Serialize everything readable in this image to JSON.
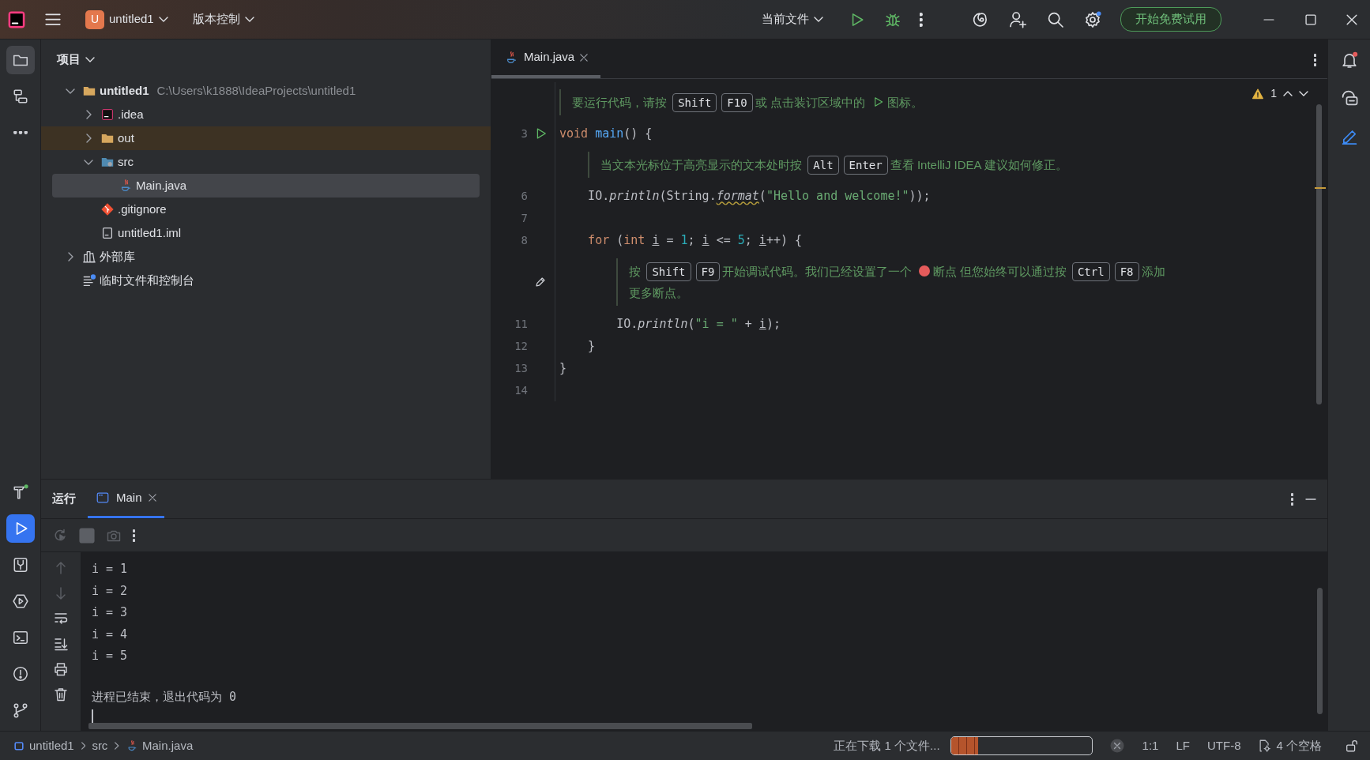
{
  "title_bar": {
    "project_badge": "U",
    "project": "untitled1",
    "vcs": "版本控制",
    "run_config": "当前文件",
    "trial_button": "开始免费试用"
  },
  "left_strip": {
    "top": [
      {
        "selected": true
      },
      {
        "selected": false
      },
      {
        "selected": false
      }
    ],
    "bottom": [
      {
        "selected": false
      },
      {
        "selected": true
      },
      {
        "selected": false
      },
      {
        "selected": false
      },
      {
        "selected": false
      },
      {
        "selected": false
      },
      {
        "selected": false
      }
    ]
  },
  "project_panel": {
    "title": "项目",
    "tree": [
      {
        "label": "untitled1",
        "path": "C:\\Users\\k1888\\IdeaProjects\\untitled1",
        "kind": "module",
        "expanded": true,
        "selected": false,
        "highlighted": false,
        "children": [
          {
            "label": ".idea",
            "kind": "config",
            "expanded": false,
            "selected": false,
            "highlighted": false
          },
          {
            "label": "out",
            "kind": "folder",
            "expanded": false,
            "selected": false,
            "highlighted": true
          },
          {
            "label": "src",
            "kind": "source",
            "expanded": true,
            "selected": false,
            "highlighted": false,
            "children": [
              {
                "label": "Main.java",
                "kind": "java",
                "selected": true,
                "highlighted": false
              }
            ]
          },
          {
            "label": ".gitignore",
            "kind": "gitignore",
            "selected": false,
            "highlighted": false
          },
          {
            "label": "untitled1.iml",
            "kind": "iml",
            "selected": false,
            "highlighted": false
          }
        ]
      },
      {
        "label": "外部库",
        "kind": "library",
        "expanded": false,
        "selected": false,
        "highlighted": false
      },
      {
        "label": "临时文件和控制台",
        "kind": "scratch",
        "selected": false,
        "highlighted": false
      }
    ]
  },
  "editor": {
    "tabs": [
      {
        "label": "Main.java",
        "selected": true
      }
    ],
    "warning_count": "1",
    "lines": [
      {
        "kind": "hint",
        "editable": false,
        "parts": [
          {
            "kind": "text",
            "text": "要运行代码，请按"
          },
          {
            "kind": "key",
            "text": "Shift"
          },
          {
            "kind": "key",
            "text": "F10"
          },
          {
            "kind": "text",
            "text": "或 点击装订区域中的"
          },
          {
            "kind": "run"
          },
          {
            "kind": "text",
            "text": "图标。"
          }
        ]
      },
      {
        "kind": "code",
        "number": "3",
        "runnable": true,
        "tokens": [
          {
            "kind": "kw",
            "text": "void "
          },
          {
            "kind": "fn",
            "text": "main"
          },
          {
            "kind": "plain",
            "text": "() {"
          }
        ],
        "children": [
          {
            "kind": "hint",
            "editable": false,
            "parts": [
              {
                "kind": "text",
                "text": "当文本光标位于高亮显示的文本处时按"
              },
              {
                "kind": "key",
                "text": "Alt"
              },
              {
                "kind": "key",
                "text": "Enter"
              },
              {
                "kind": "text",
                "text": "查看 IntelliJ IDEA 建议如何修正。"
              }
            ]
          },
          {
            "kind": "code",
            "number": "6",
            "runnable": false,
            "tokens": [
              {
                "kind": "plain",
                "text": "IO."
              },
              {
                "kind": "italic",
                "text": "println"
              },
              {
                "kind": "plain",
                "text": "(String."
              },
              {
                "kind": "warn",
                "text": "format"
              },
              {
                "kind": "plain",
                "text": "("
              },
              {
                "kind": "str",
                "text": "\"Hello and welcome!\""
              },
              {
                "kind": "plain",
                "text": "));"
              }
            ]
          },
          {
            "kind": "code",
            "number": "7",
            "runnable": false
          },
          {
            "kind": "code",
            "number": "8",
            "runnable": false,
            "tokens": [
              {
                "kind": "kw",
                "text": "for"
              },
              {
                "kind": "plain",
                "text": " ("
              },
              {
                "kind": "kw",
                "text": "int "
              },
              {
                "kind": "var",
                "text": "i"
              },
              {
                "kind": "plain",
                "text": " = "
              },
              {
                "kind": "num",
                "text": "1"
              },
              {
                "kind": "plain",
                "text": "; "
              },
              {
                "kind": "var",
                "text": "i"
              },
              {
                "kind": "plain",
                "text": " <= "
              },
              {
                "kind": "num",
                "text": "5"
              },
              {
                "kind": "plain",
                "text": "; "
              },
              {
                "kind": "var",
                "text": "i"
              },
              {
                "kind": "plain",
                "text": "++) {"
              }
            ],
            "children": [
              {
                "kind": "hint",
                "editable": true,
                "parts": [
                  {
                    "kind": "text",
                    "text": "按"
                  },
                  {
                    "kind": "key",
                    "text": "Shift"
                  },
                  {
                    "kind": "key",
                    "text": "F9"
                  },
                  {
                    "kind": "text",
                    "text": "开始调试代码。我们已经设置了一个"
                  },
                  {
                    "kind": "breakpoint"
                  },
                  {
                    "kind": "text",
                    "text": "断点 但您始终可以通过按"
                  },
                  {
                    "kind": "key",
                    "text": "Ctrl"
                  },
                  {
                    "kind": "key",
                    "text": "F8"
                  },
                  {
                    "kind": "text",
                    "text": "添加"
                  },
                  {
                    "kind": "break"
                  },
                  {
                    "kind": "text",
                    "text": "更多断点。"
                  }
                ]
              },
              {
                "kind": "code",
                "number": "11",
                "runnable": false,
                "tokens": [
                  {
                    "kind": "plain",
                    "text": "IO."
                  },
                  {
                    "kind": "italic",
                    "text": "println"
                  },
                  {
                    "kind": "plain",
                    "text": "("
                  },
                  {
                    "kind": "str",
                    "text": "\"i = \""
                  },
                  {
                    "kind": "plain",
                    "text": " + "
                  },
                  {
                    "kind": "var",
                    "text": "i"
                  },
                  {
                    "kind": "plain",
                    "text": ");"
                  }
                ]
              }
            ]
          },
          {
            "kind": "code",
            "number": "12",
            "runnable": false,
            "tokens": [
              {
                "kind": "plain",
                "text": "}"
              }
            ]
          }
        ]
      },
      {
        "kind": "code",
        "number": "13",
        "runnable": false,
        "tokens": [
          {
            "kind": "plain",
            "text": "}"
          }
        ]
      },
      {
        "kind": "code",
        "number": "14",
        "runnable": false
      }
    ]
  },
  "run_panel": {
    "title": "运行",
    "tabs": [
      {
        "label": "Main",
        "selected": true
      }
    ],
    "toolbar": [
      {
        "disabled": true
      },
      {
        "disabled": true
      },
      {
        "disabled": true
      },
      {
        "disabled": false
      }
    ],
    "side_tools": [
      {
        "disabled": true
      },
      {
        "disabled": true
      },
      {
        "disabled": false
      },
      {
        "disabled": false
      },
      {
        "disabled": false
      },
      {
        "disabled": false
      }
    ],
    "output": [
      {
        "kind": "stdout",
        "text": "i = 1"
      },
      {
        "kind": "stdout",
        "text": "i = 2"
      },
      {
        "kind": "stdout",
        "text": "i = 3"
      },
      {
        "kind": "stdout",
        "text": "i = 4"
      },
      {
        "kind": "stdout",
        "text": "i = 5"
      },
      {
        "kind": "system",
        "text": "进程已结束，退出代码为 0"
      }
    ]
  },
  "status_bar": {
    "breadcrumbs": [
      {
        "label": "untitled1",
        "kind": "module"
      },
      {
        "label": "src",
        "kind": "folder"
      },
      {
        "label": "Main.java",
        "kind": "java"
      }
    ],
    "task": "正在下载 1 个文件...",
    "progress": {
      "level": 0.19
    },
    "position": "1:1",
    "line_separator": "LF",
    "encoding": "UTF-8",
    "indent": "4 个空格"
  }
}
